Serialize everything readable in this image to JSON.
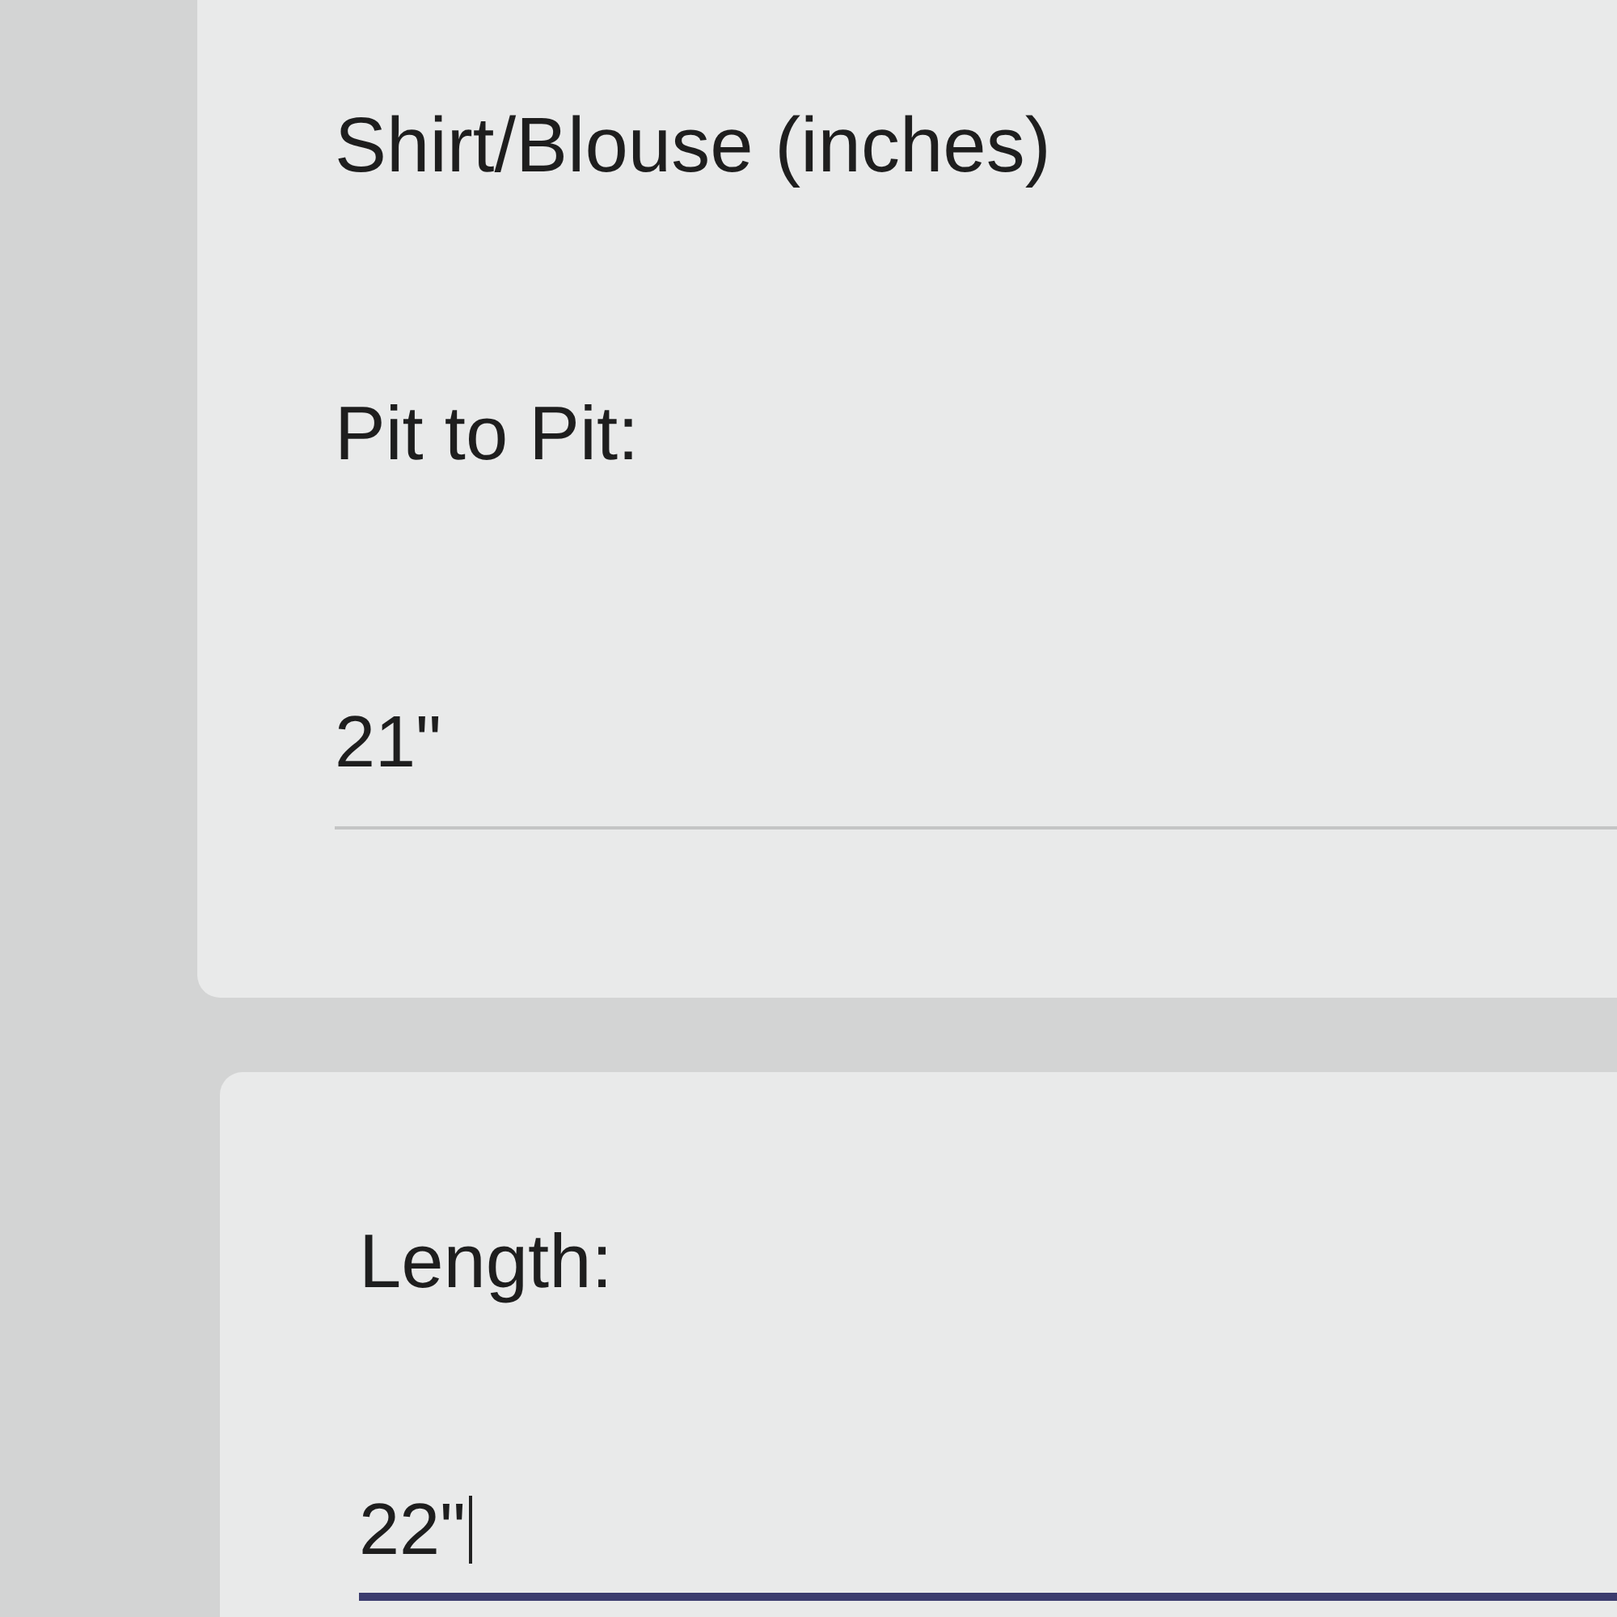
{
  "section": {
    "title": "Shirt/Blouse (inches)"
  },
  "questions": [
    {
      "label": "Pit to Pit:",
      "value": "21\"",
      "focused": false
    },
    {
      "label": "Length:",
      "value": "22\"",
      "focused": true
    }
  ]
}
